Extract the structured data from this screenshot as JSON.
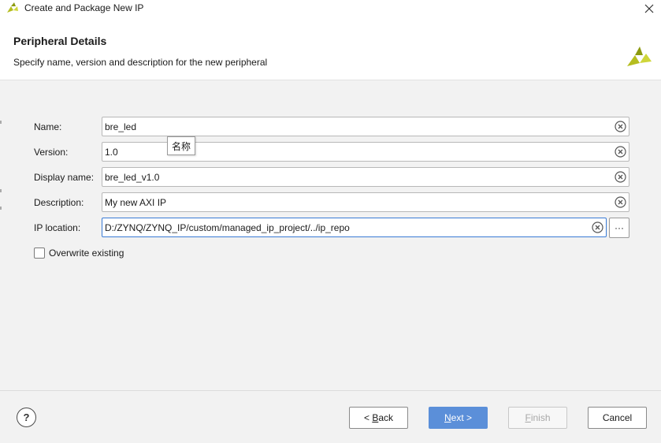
{
  "window": {
    "title": "Create and Package New IP",
    "close_icon": "close-icon"
  },
  "header": {
    "heading": "Peripheral Details",
    "subheading": "Specify name, version and description for the new peripheral",
    "logo_icon": "vivado-logo-icon"
  },
  "form": {
    "name": {
      "label": "Name:",
      "value": "bre_led"
    },
    "version": {
      "label": "Version:",
      "value": "1.0"
    },
    "display_name": {
      "label": "Display name:",
      "value": "bre_led_v1.0"
    },
    "description": {
      "label": "Description:",
      "value": "My new AXI IP"
    },
    "ip_location": {
      "label": "IP location:",
      "value": "D:/ZYNQ/ZYNQ_IP/custom/managed_ip_project/../ip_repo",
      "browse_label": "···"
    },
    "overwrite": {
      "label": "Overwrite existing",
      "checked": false
    }
  },
  "tooltip": {
    "text": "名称"
  },
  "footer": {
    "help_label": "?",
    "back": {
      "prefix": "< ",
      "mnemonic": "B",
      "rest": "ack"
    },
    "next": {
      "mnemonic": "N",
      "rest": "ext >"
    },
    "finish": {
      "mnemonic": "F",
      "rest": "inish",
      "enabled": false
    },
    "cancel": {
      "label": "Cancel"
    }
  },
  "colors": {
    "accent": "#5b8fd9",
    "focus_border": "#3a7bd5",
    "logo": "#b5bd1f"
  }
}
